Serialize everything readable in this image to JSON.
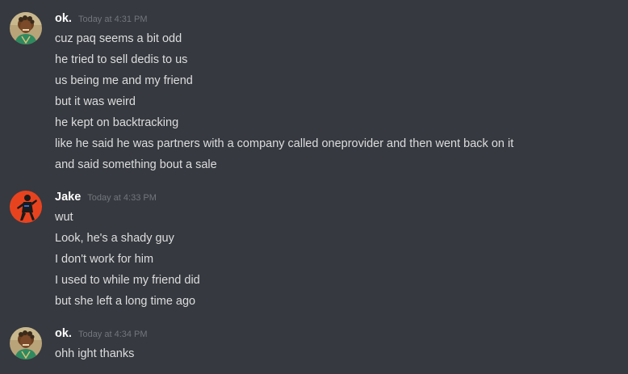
{
  "colors": {
    "background": "#36393f",
    "username": "#ffffff",
    "timestamp": "#72767d",
    "message_text": "#dcddde"
  },
  "messages": [
    {
      "author": "ok.",
      "timestamp": "Today at 4:31 PM",
      "avatar_icon": "user-avatar-icon",
      "lines": [
        "cuz paq seems a bit odd",
        "he tried to sell dedis to us",
        "us being me and my friend",
        "but it was weird",
        "he kept on backtracking",
        "like he said he was partners with a company called oneprovider and then went back on it",
        "and said something bout a sale"
      ]
    },
    {
      "author": "Jake",
      "timestamp": "Today at 4:33 PM",
      "avatar_icon": "user-avatar-icon",
      "lines": [
        "wut",
        "Look, he's a shady guy",
        "I don't work for him",
        "I used to while my friend did",
        "but she left a long time ago"
      ]
    },
    {
      "author": "ok.",
      "timestamp": "Today at 4:34 PM",
      "avatar_icon": "user-avatar-icon",
      "lines": [
        "ohh ight thanks"
      ]
    }
  ]
}
